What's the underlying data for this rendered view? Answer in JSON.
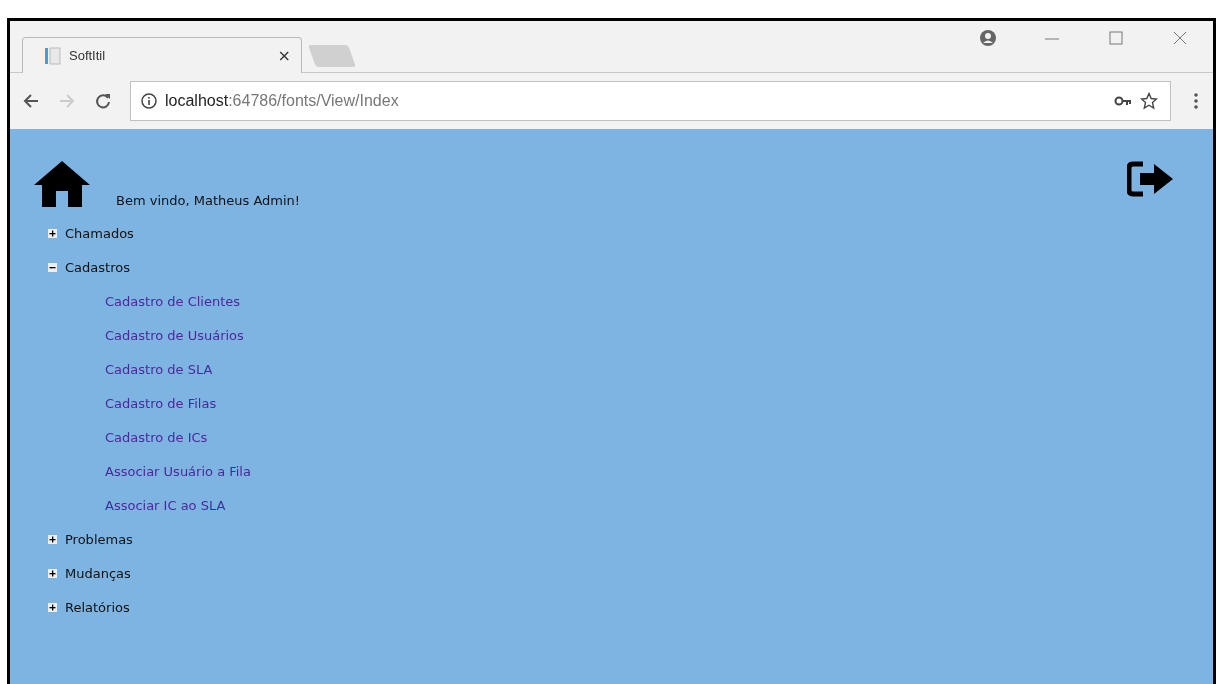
{
  "browser": {
    "tab": {
      "title": "SoftItil",
      "close": "×"
    },
    "address": {
      "host": "localhost",
      "path": ":64786/fonts/View/Index"
    }
  },
  "page": {
    "welcome": "Bem vindo, Matheus Admin!",
    "menu": [
      {
        "label": "Chamados",
        "expanded": false
      },
      {
        "label": "Cadastros",
        "expanded": true,
        "children": [
          {
            "label": "Cadastro de Clientes"
          },
          {
            "label": "Cadastro de Usuários"
          },
          {
            "label": "Cadastro de SLA"
          },
          {
            "label": "Cadastro de Filas"
          },
          {
            "label": "Cadastro de ICs"
          },
          {
            "label": "Associar Usuário a Fila"
          },
          {
            "label": "Associar IC ao SLA"
          }
        ]
      },
      {
        "label": "Problemas",
        "expanded": false
      },
      {
        "label": "Mudanças",
        "expanded": false
      },
      {
        "label": "Relatórios",
        "expanded": false
      }
    ]
  }
}
